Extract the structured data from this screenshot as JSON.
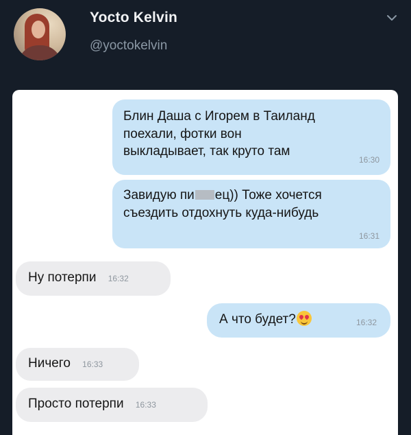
{
  "profile": {
    "name": "Yocto Kelvin",
    "handle": "@yoctokelvin",
    "avatar_icon": "profile-photo",
    "menu_icon": "chevron-down-icon"
  },
  "colors": {
    "background": "#151d28",
    "outgoing_bubble": "#c9e4f7",
    "incoming_bubble": "#ececee"
  },
  "messages": [
    {
      "direction": "outgoing",
      "text": "Блин Даша с Игорем в Таиланд\nпоехали, фотки вон\nвыкладывает, так круто там",
      "time": "16:30"
    },
    {
      "direction": "outgoing",
      "text_before": "Завидую пи",
      "text_after": "ец)) Тоже хочется\nсъездить отдохнуть куда-нибудь",
      "time": "16:31"
    },
    {
      "direction": "incoming",
      "text": "Ну потерпи",
      "time": "16:32"
    },
    {
      "direction": "outgoing",
      "text": "А что будет?",
      "emoji": "heart-eyes-emoji",
      "time": "16:32"
    },
    {
      "direction": "incoming",
      "text": "Ничего",
      "time": "16:33"
    },
    {
      "direction": "incoming",
      "text": "Просто потерпи",
      "time": "16:33"
    }
  ]
}
